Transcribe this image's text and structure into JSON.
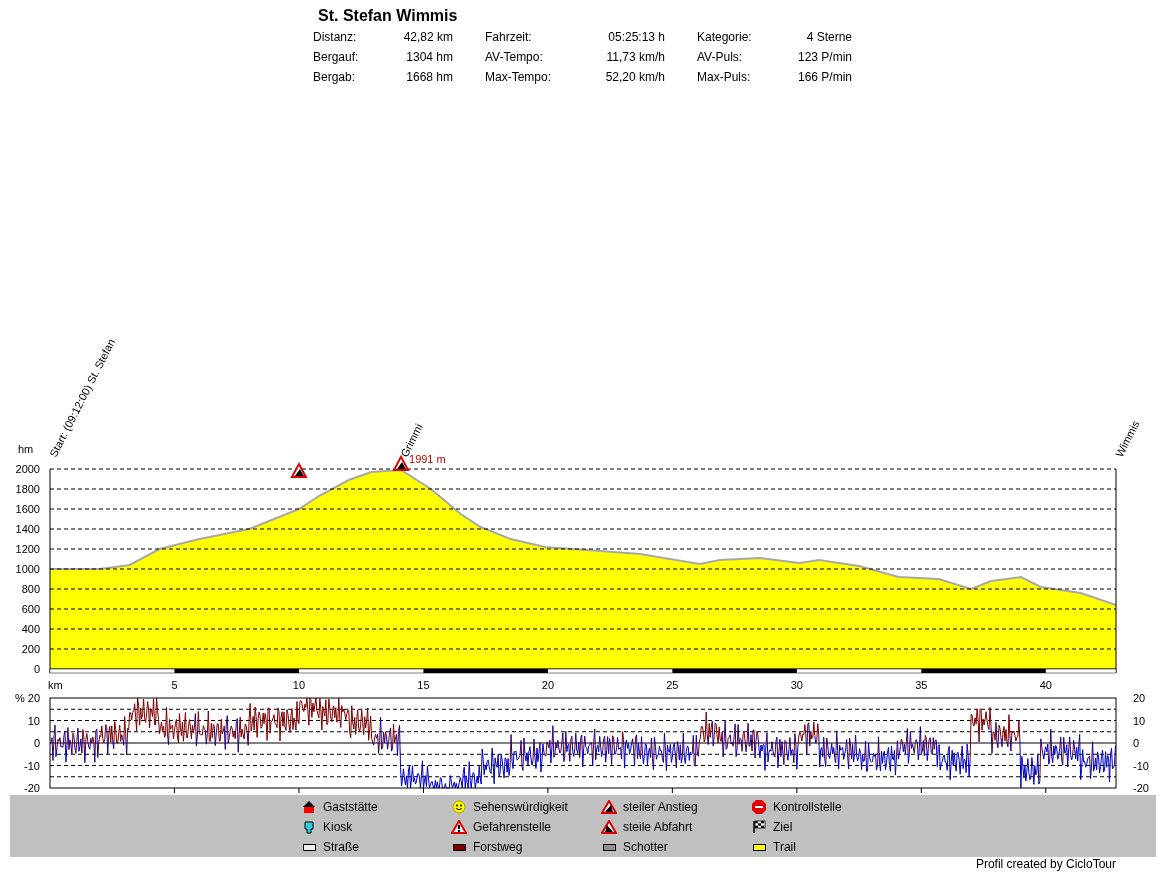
{
  "title": "St. Stefan Wimmis",
  "stats": [
    {
      "label": "Distanz:",
      "value": "42,82 km"
    },
    {
      "label": "Fahrzeit:",
      "value": "05:25:13 h"
    },
    {
      "label": "Kategorie:",
      "value": "4 Sterne"
    },
    {
      "label": "Bergauf:",
      "value": "1304 hm"
    },
    {
      "label": "AV-Tempo:",
      "value": "11,73 km/h"
    },
    {
      "label": "AV-Puls:",
      "value": "123 P/min"
    },
    {
      "label": "Bergab:",
      "value": "1668 hm"
    },
    {
      "label": "Max-Tempo:",
      "value": "52,20 km/h"
    },
    {
      "label": "Max-Puls:",
      "value": "166 P/min"
    }
  ],
  "profile": {
    "chart_data": {
      "type": "area",
      "xlabel": "km",
      "ylabel": "hm",
      "x": [
        0,
        2.0,
        3.2,
        4.4,
        6.0,
        8.0,
        10.0,
        10.8,
        12.0,
        12.9,
        14.1,
        15.3,
        16.5,
        17.3,
        18.5,
        19.9,
        22.1,
        23.7,
        26.1,
        26.9,
        28.5,
        30.1,
        30.9,
        32.5,
        34.1,
        35.7,
        37.0,
        37.8,
        39.0,
        39.8,
        41.4,
        42.82
      ],
      "series": [
        {
          "color": "#ffff00",
          "values": [
            1000,
            1000,
            1040,
            1200,
            1300,
            1400,
            1600,
            1730,
            1890,
            1970,
            1991,
            1800,
            1550,
            1420,
            1300,
            1220,
            1180,
            1150,
            1050,
            1090,
            1110,
            1060,
            1090,
            1030,
            920,
            900,
            800,
            880,
            920,
            820,
            760,
            640
          ]
        }
      ],
      "xlim": [
        0,
        42.82
      ],
      "ylim": [
        0,
        2000
      ],
      "xticks": [
        5,
        10,
        15,
        20,
        25,
        30,
        35,
        40
      ],
      "yticks": [
        0,
        200,
        400,
        600,
        800,
        1000,
        1200,
        1400,
        1600,
        1800,
        2000
      ],
      "grid": true
    },
    "waypoints": [
      {
        "kind": "label",
        "text": "Start: (09:12:00) St. Stefan"
      },
      {
        "kind": "steep_climb"
      },
      {
        "kind": "steep_climb",
        "text": "Grimmi",
        "elevation_label": "1991 m"
      },
      {
        "kind": "label",
        "text": "Wimmis"
      }
    ]
  },
  "slope": {
    "unit": "%",
    "left_ticks": [
      "20",
      "10",
      "0",
      "-10",
      "-20"
    ],
    "right_ticks": [
      "20",
      "10",
      "0",
      "-10",
      "-20"
    ]
  },
  "legend": [
    {
      "label": "Gaststätte",
      "kind": "restaurant"
    },
    {
      "label": "Sehenswürdigkeit",
      "kind": "sight"
    },
    {
      "label": "steiler Anstieg",
      "kind": "steep_climb"
    },
    {
      "label": "Kontrollstelle",
      "kind": "checkpoint"
    },
    {
      "label": "Kiosk",
      "kind": "kiosk"
    },
    {
      "label": "Gefahrenstelle",
      "kind": "danger"
    },
    {
      "label": "steile Abfahrt",
      "kind": "steep_descent"
    },
    {
      "label": "Ziel",
      "kind": "finish"
    },
    {
      "label": "Straße",
      "kind": "road"
    },
    {
      "label": "Forstweg",
      "kind": "forest_road"
    },
    {
      "label": "Schotter",
      "kind": "gravel"
    },
    {
      "label": "Trail",
      "kind": "trail"
    }
  ],
  "footer": "Profil created by CicloTour"
}
